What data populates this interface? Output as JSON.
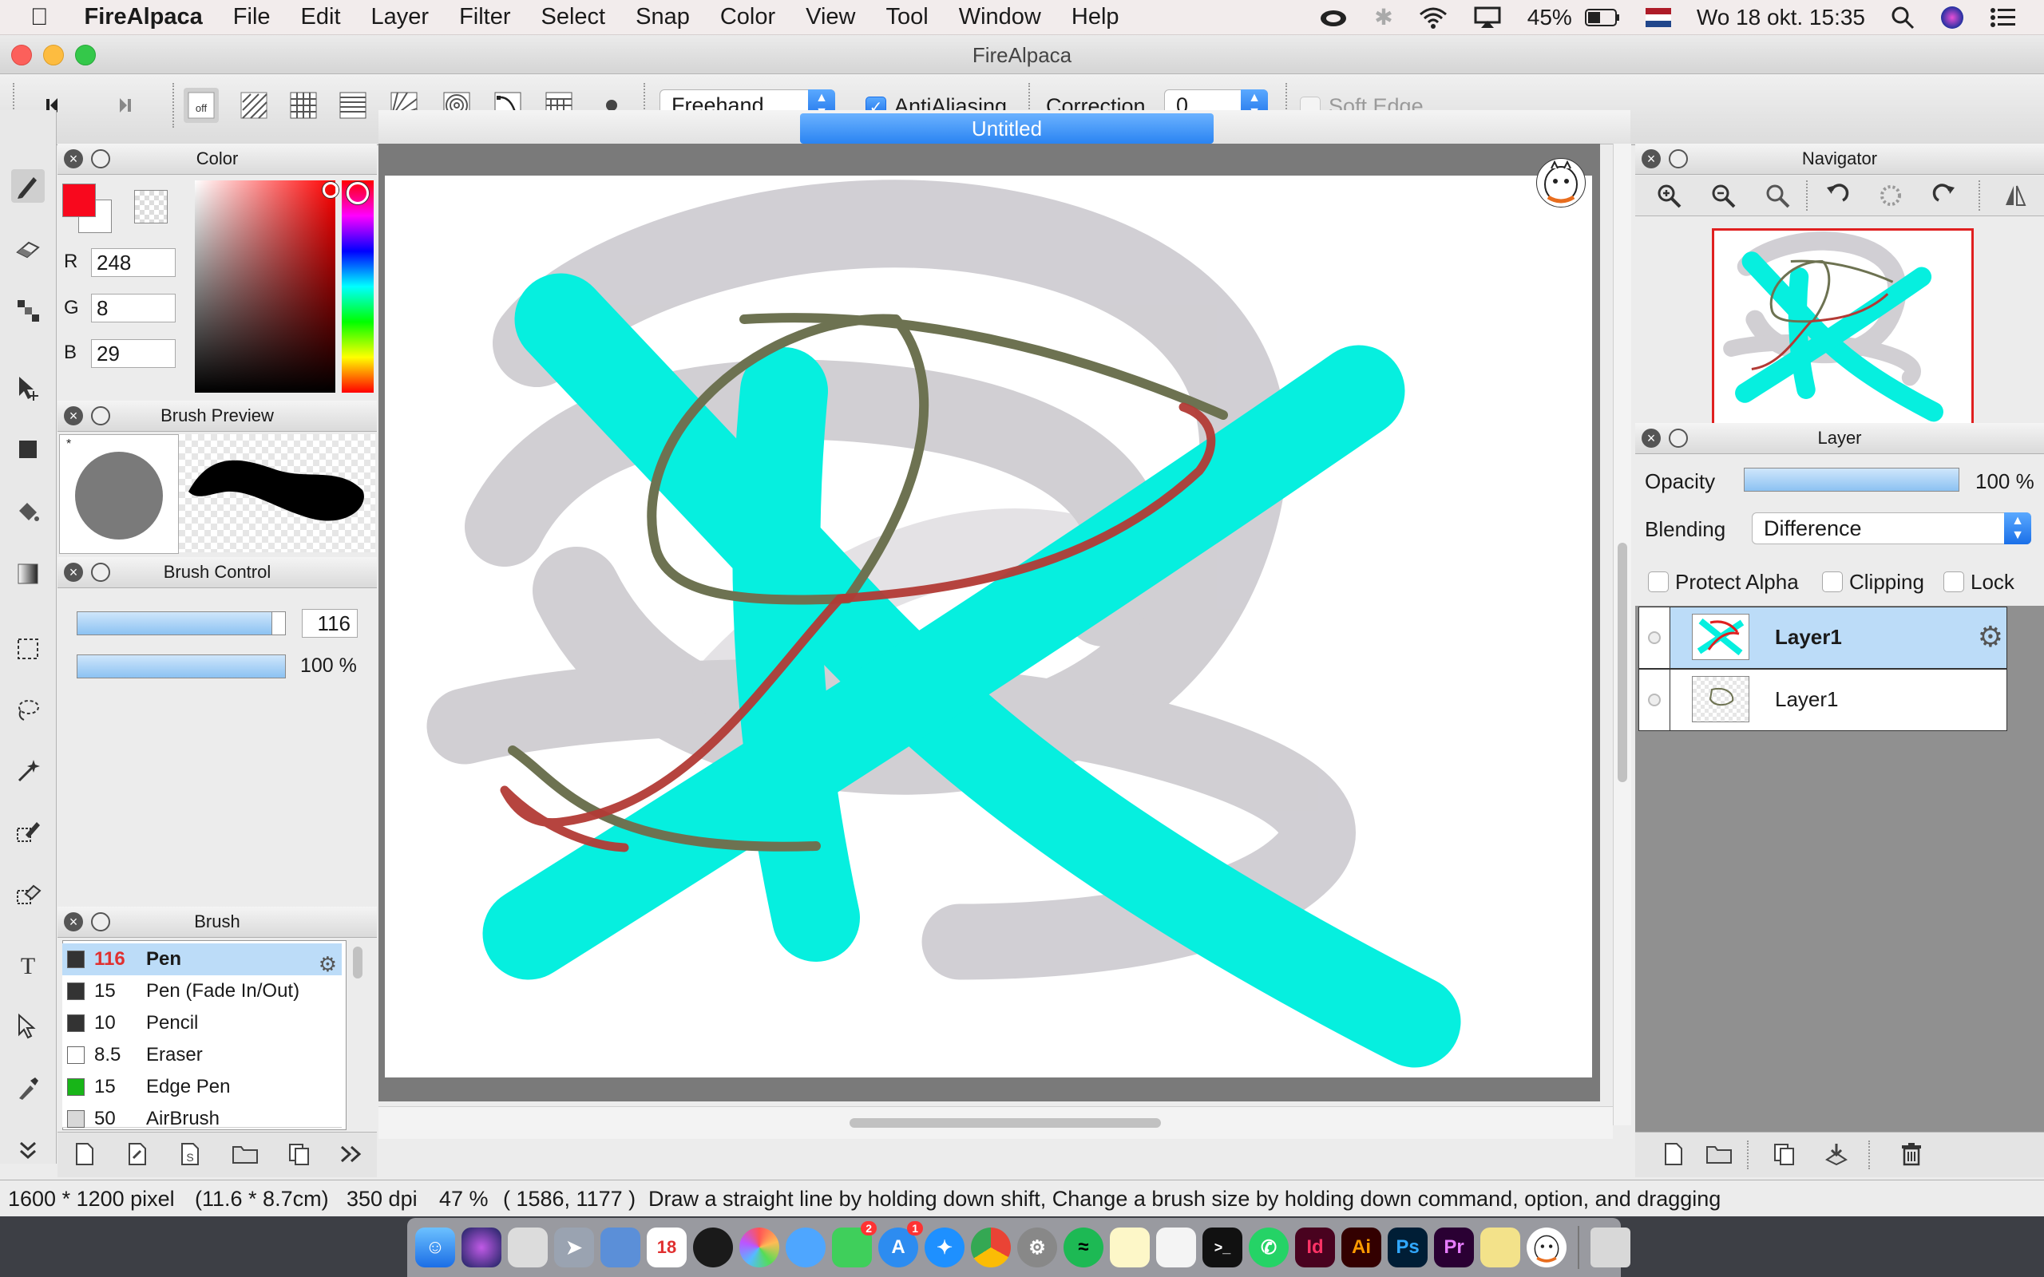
{
  "menubar": {
    "app_name": "FireAlpaca",
    "items": [
      "File",
      "Edit",
      "Layer",
      "Filter",
      "Select",
      "Snap",
      "Color",
      "View",
      "Tool",
      "Window",
      "Help"
    ],
    "battery": "45%",
    "datetime": "Wo 18 okt. 15:35"
  },
  "window": {
    "title": "FireAlpaca"
  },
  "toolbar": {
    "snap_off_label": "off",
    "stroke_mode": "Freehand",
    "antialiasing_label": "AntiAliasing",
    "antialiasing_checked": true,
    "correction_label": "Correction",
    "correction_value": "0",
    "soft_edge_label": "Soft Edge",
    "soft_edge_checked": false
  },
  "color_panel": {
    "title": "Color",
    "r_label": "R",
    "r": "248",
    "g_label": "G",
    "g": "8",
    "b_label": "B",
    "b": "29",
    "foreground": "#f8081d",
    "background": "#ffffff"
  },
  "brush_preview": {
    "title": "Brush Preview"
  },
  "brush_control": {
    "title": "Brush Control",
    "size": "116",
    "opacity": "100 %"
  },
  "brush_panel": {
    "title": "Brush",
    "items": [
      {
        "size": "116",
        "name": "Pen",
        "color": "#333333",
        "selected": true
      },
      {
        "size": "15",
        "name": "Pen (Fade In/Out)",
        "color": "#333333"
      },
      {
        "size": "10",
        "name": "Pencil",
        "color": "#333333"
      },
      {
        "size": "8.5",
        "name": "Eraser",
        "color": "#ffffff"
      },
      {
        "size": "15",
        "name": "Edge Pen",
        "color": "#18b518"
      },
      {
        "size": "50",
        "name": "AirBrush",
        "color": "#d8d8d8"
      }
    ]
  },
  "canvas": {
    "tab_title": "Untitled"
  },
  "navigator": {
    "title": "Navigator"
  },
  "layer_panel": {
    "title": "Layer",
    "opacity_label": "Opacity",
    "opacity": "100 %",
    "blending_label": "Blending",
    "blending": "Difference",
    "protect_alpha_label": "Protect Alpha",
    "clipping_label": "Clipping",
    "lock_label": "Lock",
    "layers": [
      {
        "name": "Layer1",
        "selected": true
      },
      {
        "name": "Layer1",
        "selected": false
      }
    ]
  },
  "statusbar": {
    "dimensions": "1600 * 1200 pixel",
    "physical": "(11.6 * 8.7cm)",
    "dpi": "350 dpi",
    "zoom": "47 %",
    "cursor": "( 1586, 1177 )",
    "hint": "Draw a straight line by holding down shift, Change a brush size by holding down command, option, and dragging"
  },
  "dock": {
    "badge_messages": "2",
    "badge_appstore": "1",
    "calendar_day": "18",
    "apps": [
      "Id",
      "Ai",
      "Ps",
      "Pr"
    ]
  }
}
